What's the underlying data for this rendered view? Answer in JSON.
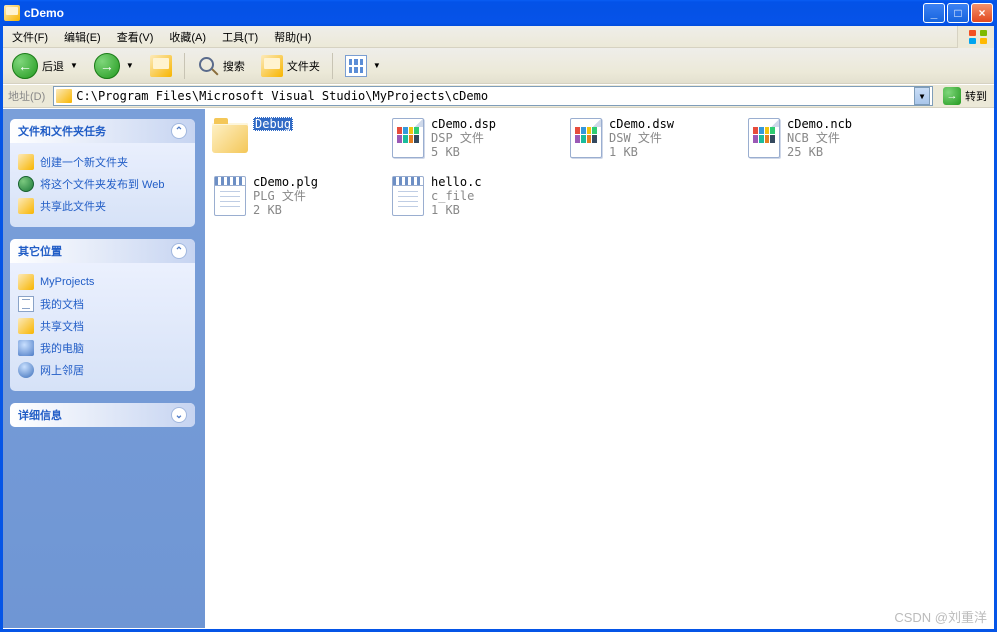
{
  "window": {
    "title": "cDemo"
  },
  "menu": {
    "file": "文件(F)",
    "edit": "编辑(E)",
    "view": "查看(V)",
    "favorites": "收藏(A)",
    "tools": "工具(T)",
    "help": "帮助(H)"
  },
  "toolbar": {
    "back": "后退",
    "search": "搜索",
    "folders": "文件夹"
  },
  "address": {
    "label": "地址(D)",
    "path": "C:\\Program Files\\Microsoft Visual Studio\\MyProjects\\cDemo",
    "go": "转到"
  },
  "sidebar": {
    "tasks_title": "文件和文件夹任务",
    "tasks": {
      "new_folder": "创建一个新文件夹",
      "publish": "将这个文件夹发布到 Web",
      "share": "共享此文件夹"
    },
    "other_title": "其它位置",
    "other": {
      "myprojects": "MyProjects",
      "mydocs": "我的文档",
      "shared": "共享文档",
      "mycomputer": "我的电脑",
      "network": "网上邻居"
    },
    "details_title": "详细信息"
  },
  "files": [
    {
      "name": "Debug",
      "type": "folder",
      "selected": true
    },
    {
      "name": "cDemo.dsp",
      "sub1": "DSP 文件",
      "sub2": "5 KB",
      "type": "dsp"
    },
    {
      "name": "cDemo.dsw",
      "sub1": "DSW 文件",
      "sub2": "1 KB",
      "type": "dsw"
    },
    {
      "name": "cDemo.ncb",
      "sub1": "NCB 文件",
      "sub2": "25 KB",
      "type": "ncb"
    },
    {
      "name": "cDemo.plg",
      "sub1": "PLG 文件",
      "sub2": "2 KB",
      "type": "plg"
    },
    {
      "name": "hello.c",
      "sub1": "c_file",
      "sub2": "1 KB",
      "type": "c"
    }
  ],
  "watermark": "CSDN @刘重洋"
}
